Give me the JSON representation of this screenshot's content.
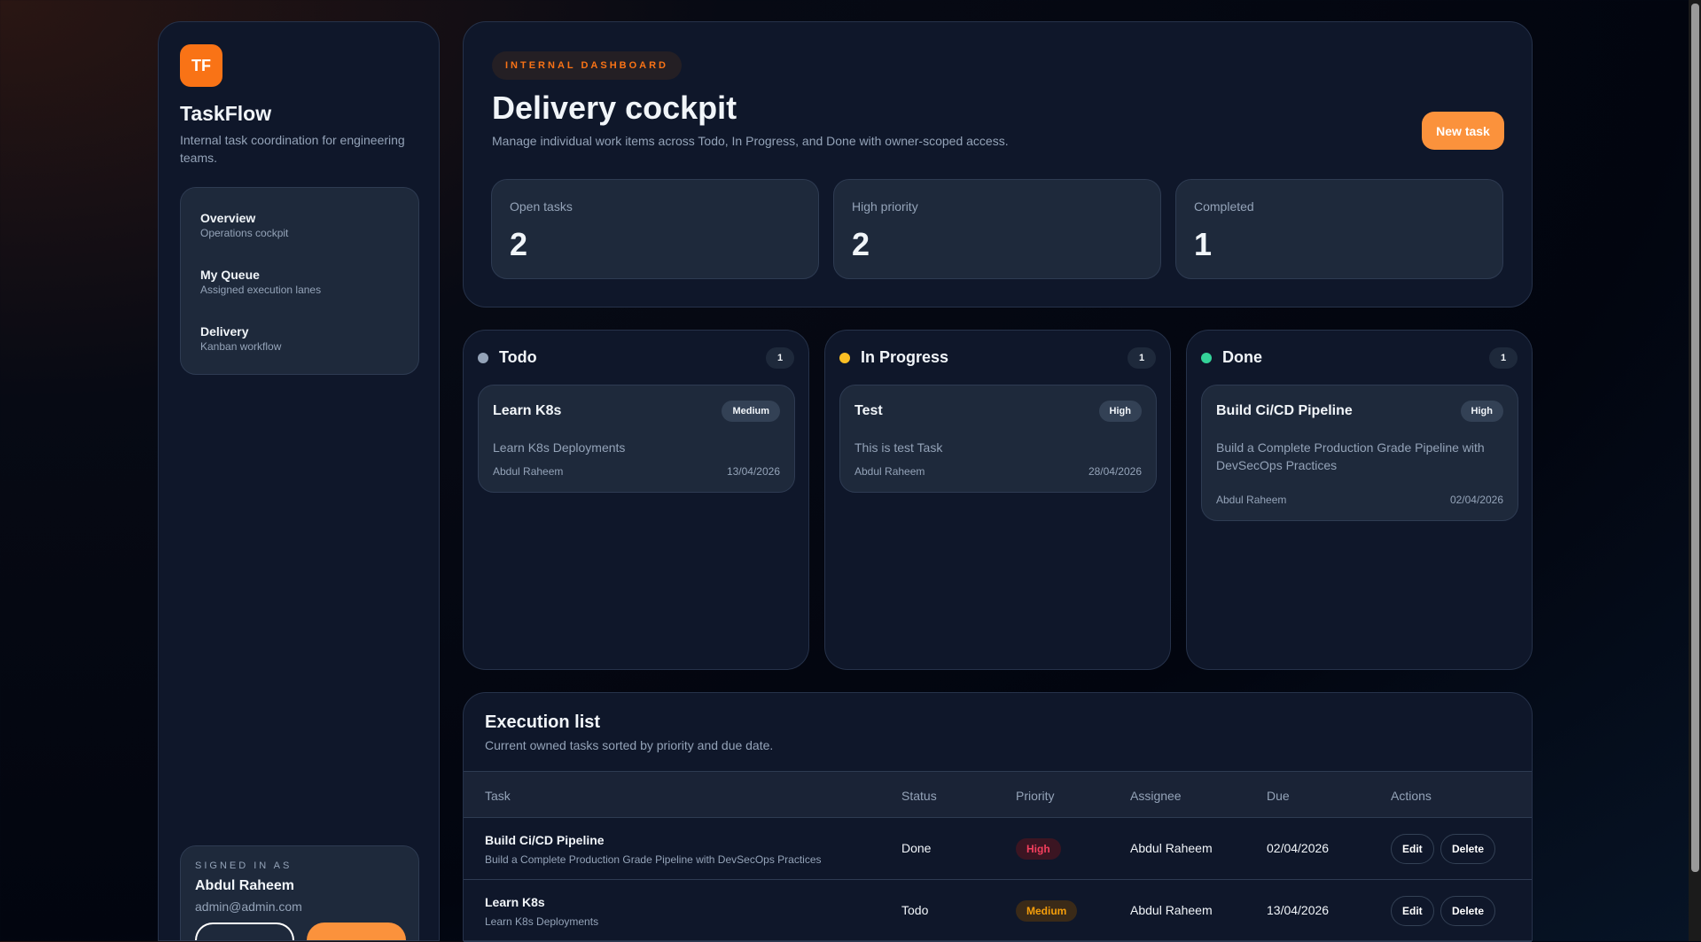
{
  "sidebar": {
    "logo": "TF",
    "brand": "TaskFlow",
    "description": "Internal task coordination for engineering teams.",
    "nav": [
      {
        "title": "Overview",
        "sub": "Operations cockpit"
      },
      {
        "title": "My Queue",
        "sub": "Assigned execution lanes"
      },
      {
        "title": "Delivery",
        "sub": "Kanban workflow"
      }
    ],
    "signed_label": "SIGNED IN AS",
    "user_name": "Abdul Raheem",
    "user_email": "admin@admin.com"
  },
  "header": {
    "badge": "INTERNAL DASHBOARD",
    "title": "Delivery cockpit",
    "subtitle": "Manage individual work items across Todo, In Progress, and Done with owner-scoped access.",
    "new_task": "New task",
    "stats": [
      {
        "label": "Open tasks",
        "value": "2"
      },
      {
        "label": "High priority",
        "value": "2"
      },
      {
        "label": "Completed",
        "value": "1"
      }
    ]
  },
  "columns": [
    {
      "title": "Todo",
      "count": "1",
      "color": "#94a3b8",
      "cards": [
        {
          "title": "Learn K8s",
          "priority": "Medium",
          "desc": "Learn K8s Deployments",
          "assignee": "Abdul Raheem",
          "due": "13/04/2026"
        }
      ]
    },
    {
      "title": "In Progress",
      "count": "1",
      "color": "#fbbf24",
      "cards": [
        {
          "title": "Test",
          "priority": "High",
          "desc": "This is test Task",
          "assignee": "Abdul Raheem",
          "due": "28/04/2026"
        }
      ]
    },
    {
      "title": "Done",
      "count": "1",
      "color": "#34d399",
      "cards": [
        {
          "title": "Build Ci/CD Pipeline",
          "priority": "High",
          "desc": "Build a Complete Production Grade Pipeline with DevSecOps Practices",
          "assignee": "Abdul Raheem",
          "due": "02/04/2026"
        }
      ]
    }
  ],
  "execution": {
    "title": "Execution list",
    "subtitle": "Current owned tasks sorted by priority and due date.",
    "headers": [
      "Task",
      "Status",
      "Priority",
      "Assignee",
      "Due",
      "Actions"
    ],
    "rows": [
      {
        "name": "Build Ci/CD Pipeline",
        "desc": "Build a Complete Production Grade Pipeline with DevSecOps Practices",
        "status": "Done",
        "priority": "High",
        "assignee": "Abdul Raheem",
        "due": "02/04/2026"
      },
      {
        "name": "Learn K8s",
        "desc": "Learn K8s Deployments",
        "status": "Todo",
        "priority": "Medium",
        "assignee": "Abdul Raheem",
        "due": "13/04/2026"
      }
    ],
    "edit": "Edit",
    "delete": "Delete"
  },
  "colors": {
    "accent": "#fb923c",
    "high_bg": "#3b1522",
    "high_fg": "#f43f5e",
    "medium_bg": "#3a2a18",
    "medium_fg": "#f59e0b"
  }
}
